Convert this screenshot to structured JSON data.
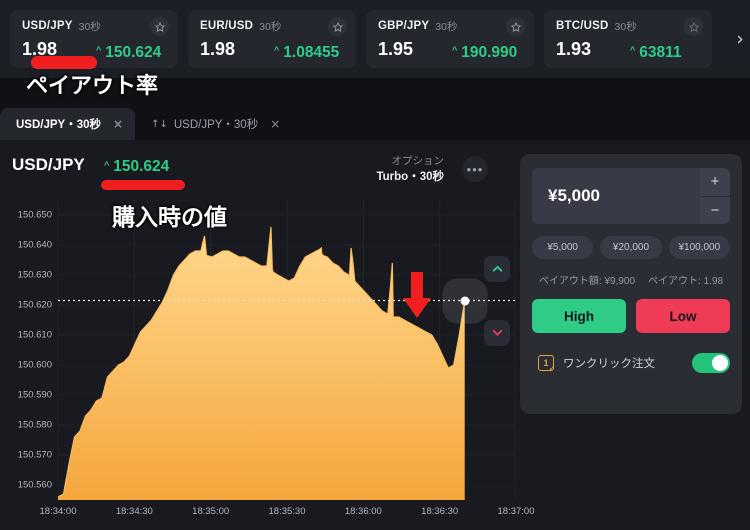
{
  "asset_strip": {
    "next_icon": "chevron-right-icon",
    "cards": [
      {
        "pair": "USD/JPY",
        "duration": "30秒",
        "payout": "1.98",
        "price": "150.624",
        "trend": "up",
        "star": "star-icon"
      },
      {
        "pair": "EUR/USD",
        "duration": "30秒",
        "payout": "1.98",
        "price": "1.08455",
        "trend": "up",
        "star": "star-icon"
      },
      {
        "pair": "GBP/JPY",
        "duration": "30秒",
        "payout": "1.95",
        "price": "190.990",
        "trend": "up",
        "star": "star-icon"
      },
      {
        "pair": "BTC/USD",
        "duration": "30秒",
        "payout": "1.93",
        "price": "63811",
        "trend": "up",
        "star": "star-icon"
      }
    ]
  },
  "tabs": [
    {
      "label": "USD/JPY・30秒",
      "active": true,
      "close": "×",
      "prefix": ""
    },
    {
      "label": "USD/JPY・30秒",
      "active": false,
      "close": "×",
      "prefix": "↑↓"
    }
  ],
  "chart_header": {
    "pair": "USD/JPY",
    "price": "150.624",
    "trend_caret": "^",
    "option_label": "オプション",
    "option_value": "Turbo・30秒",
    "more_button": "•••"
  },
  "trade_panel": {
    "amount": "¥5,000",
    "increase_label": "+",
    "decrease_label": "−",
    "quick_amounts": [
      "¥5,000",
      "¥20,000",
      "¥100,000"
    ],
    "payout_amount_label": "ペイアウト額: ¥9,900",
    "payout_rate_label": "ペイアウト: 1.98",
    "high_label": "High",
    "low_label": "Low",
    "high_color": "#2ecc87",
    "low_color": "#ef3b55",
    "oneclick_label": "ワンクリック注文",
    "oneclick_icon_text": "1",
    "oneclick_enabled": true
  },
  "directional_buttons": {
    "up_icon": "chevron-up-icon",
    "down_icon": "chevron-down-icon",
    "up_color": "#2ecc87",
    "down_color": "#ef3b55"
  },
  "annotations": [
    {
      "name": "payout-rate-annotation",
      "text": "ペイアウト率"
    },
    {
      "name": "purchase-price-annotation",
      "text": "購入時の値"
    },
    {
      "name": "current-price-arrow-annotation",
      "text": ""
    }
  ],
  "chart_data": {
    "type": "area",
    "title": "USD/JPY",
    "xlabel": "",
    "ylabel": "",
    "ylim": [
      150.555,
      150.655
    ],
    "yticks": [
      "150.650",
      "150.640",
      "150.630",
      "150.620",
      "150.610",
      "150.600",
      "150.590",
      "150.580",
      "150.570",
      "150.560"
    ],
    "ytick_values": [
      150.65,
      150.64,
      150.63,
      150.62,
      150.61,
      150.6,
      150.59,
      150.58,
      150.57,
      150.56
    ],
    "xticks": [
      "18:34:00",
      "18:34:30",
      "18:35:00",
      "18:35:30",
      "18:36:00",
      "18:36:30",
      "18:37:00"
    ],
    "grid": true,
    "legend": "none",
    "line_color": "#f0a33c",
    "fill_top_color": "#ffd68a",
    "fill_bottom_color": "#f5a93f",
    "current_price": 150.6215,
    "current_price_line": "dotted",
    "x": [
      0.0,
      1.2,
      2.4,
      3.6,
      4.8,
      6.0,
      7.2,
      8.4,
      9.6,
      10.8,
      12.0,
      13.2,
      14.4,
      15.6,
      16.8,
      18.0,
      19.2,
      20.4,
      21.6,
      22.8,
      24.0,
      25.2,
      26.4,
      27.6,
      28.8,
      30.0,
      31.2,
      32.4,
      33.6,
      34.8,
      36.0,
      37.2,
      38.4,
      39.6,
      40.8,
      42.0,
      43.2,
      44.4,
      45.6,
      46.8,
      48.0,
      49.2,
      50.4,
      51.6,
      52.8,
      54.0,
      55.2,
      56.4,
      57.6,
      58.8,
      60.0,
      61.2,
      62.4,
      63.6,
      64.8,
      66.0,
      67.2,
      68.4,
      69.6,
      70.8,
      72.0,
      73.2,
      74.4,
      75.6,
      76.8,
      78.0,
      79.2,
      80.4,
      81.6,
      82.8,
      84.0,
      85.2,
      86.4,
      87.6,
      88.8
    ],
    "y": [
      150.556,
      150.557,
      150.567,
      150.576,
      150.578,
      150.583,
      150.585,
      150.588,
      150.589,
      150.596,
      150.598,
      150.6,
      150.601,
      150.603,
      150.607,
      150.611,
      150.613,
      150.615,
      150.618,
      150.621,
      150.625,
      150.63,
      150.633,
      150.635,
      150.637,
      150.638,
      150.638,
      150.637,
      150.636,
      150.637,
      150.638,
      150.638,
      150.637,
      150.636,
      150.636,
      150.635,
      150.634,
      150.633,
      150.633,
      150.632,
      150.63,
      150.629,
      150.628,
      150.629,
      150.633,
      150.636,
      150.637,
      150.638,
      150.637,
      150.636,
      150.634,
      150.633,
      150.631,
      150.629,
      150.628,
      150.626,
      150.624,
      150.622,
      150.62,
      150.618,
      150.617,
      150.616,
      150.616,
      150.615,
      150.614,
      150.613,
      150.612,
      150.611,
      150.61,
      150.607,
      150.603,
      150.599,
      150.6,
      150.61,
      150.6215
    ],
    "spikes": [
      {
        "x": 32.0,
        "y": 150.643
      },
      {
        "x": 46.5,
        "y": 150.646
      },
      {
        "x": 57.5,
        "y": 150.639
      },
      {
        "x": 64.0,
        "y": 150.639
      },
      {
        "x": 73.0,
        "y": 150.634
      }
    ]
  }
}
